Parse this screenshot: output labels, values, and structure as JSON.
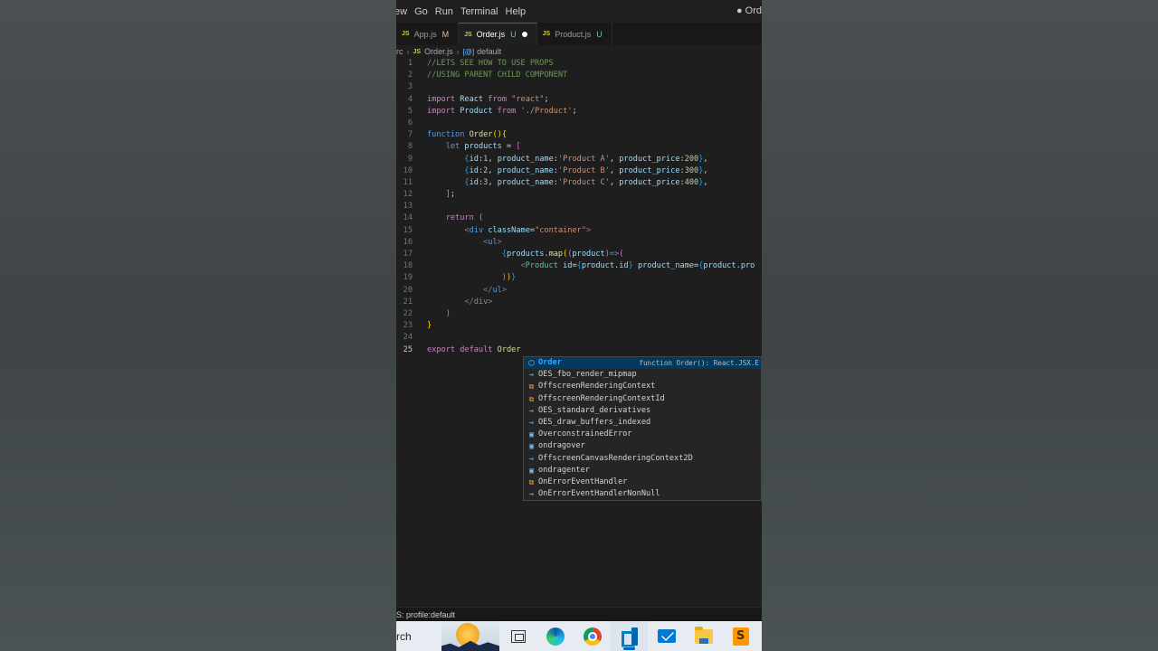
{
  "menu": {
    "items": [
      "ew",
      "Go",
      "Run",
      "Terminal",
      "Help"
    ],
    "window_title": "● Ord"
  },
  "tabs": [
    {
      "icon": "JS",
      "label": "App.js",
      "status": "M"
    },
    {
      "icon": "JS",
      "label": "Order.js",
      "status": "U",
      "modified": true
    },
    {
      "icon": "JS",
      "label": "Product.js",
      "status": "U"
    }
  ],
  "breadcrumb": {
    "folder": "rc",
    "file_icon": "JS",
    "file": "Order.js",
    "symbol_icon": "[@]",
    "symbol": "default"
  },
  "editor": {
    "current_line": 25,
    "line_numbers": [
      "1",
      "2",
      "3",
      "4",
      "5",
      "6",
      "7",
      "8",
      "9",
      "10",
      "11",
      "12",
      "13",
      "14",
      "15",
      "16",
      "17",
      "18",
      "19",
      "20",
      "21",
      "22",
      "23",
      "24",
      "25"
    ],
    "lines": {
      "l1": "//LETS SEE HOW TO USE PROPS",
      "l2": "//USING PARENT CHILD COMPONENT",
      "l4a": "import",
      "l4b": "React",
      "l4c": "from",
      "l4d": "\"react\"",
      "l5a": "import",
      "l5b": "Product",
      "l5c": "from",
      "l5d": "'./Product'",
      "l7a": "function",
      "l7b": "Order",
      "l8a": "let",
      "l8b": "products",
      "r1": {
        "id": "1",
        "name": "'Product A'",
        "price": "200"
      },
      "r2": {
        "id": "2",
        "name": "'Product B'",
        "price": "300"
      },
      "r3": {
        "id": "3",
        "name": "'Product C'",
        "price": "400"
      },
      "l14": "return",
      "l15a": "div",
      "l15b": "className",
      "l15c": "\"container\"",
      "l16": "ul",
      "l17a": "products",
      "l17b": "map",
      "l17c": "product",
      "l18a": "Product",
      "l18b": "id",
      "l18c": "product",
      "l18d": "id",
      "l18e": "product_name",
      "l18f": "product.pro",
      "l20": "ul",
      "l21": "div",
      "l25a": "export",
      "l25b": "default",
      "l25c": "Order"
    }
  },
  "suggestions": [
    {
      "icon": "module",
      "pre": "",
      "hl": "Order",
      "post": "",
      "detail": "function Order(): React.JSX.E",
      "selected": true
    },
    {
      "icon": "property",
      "text": "OES_fbo_render_mipmap"
    },
    {
      "icon": "class",
      "text": "OffscreenRenderingContext"
    },
    {
      "icon": "class",
      "text": "OffscreenRenderingContextId"
    },
    {
      "icon": "property",
      "text": "OES_standard_derivatives"
    },
    {
      "icon": "property",
      "text": "OES_draw_buffers_indexed"
    },
    {
      "icon": "variable",
      "text": "OverconstrainedError"
    },
    {
      "icon": "variable",
      "text": "ondragover"
    },
    {
      "icon": "property",
      "text": "OffscreenCanvasRenderingContext2D"
    },
    {
      "icon": "variable",
      "text": "ondragenter"
    },
    {
      "icon": "class",
      "text": "OnErrorEventHandler"
    },
    {
      "icon": "property",
      "text": "OnErrorEventHandlerNonNull"
    }
  ],
  "statusbar": {
    "text": "S: profile:default"
  },
  "taskbar": {
    "search_text": "rch",
    "apps": [
      "task-view-icon",
      "edge-icon",
      "chrome-icon",
      "vscode-icon",
      "mail-icon",
      "file-explorer-icon",
      "sublime-text-icon"
    ],
    "sublime_letter": "S"
  }
}
